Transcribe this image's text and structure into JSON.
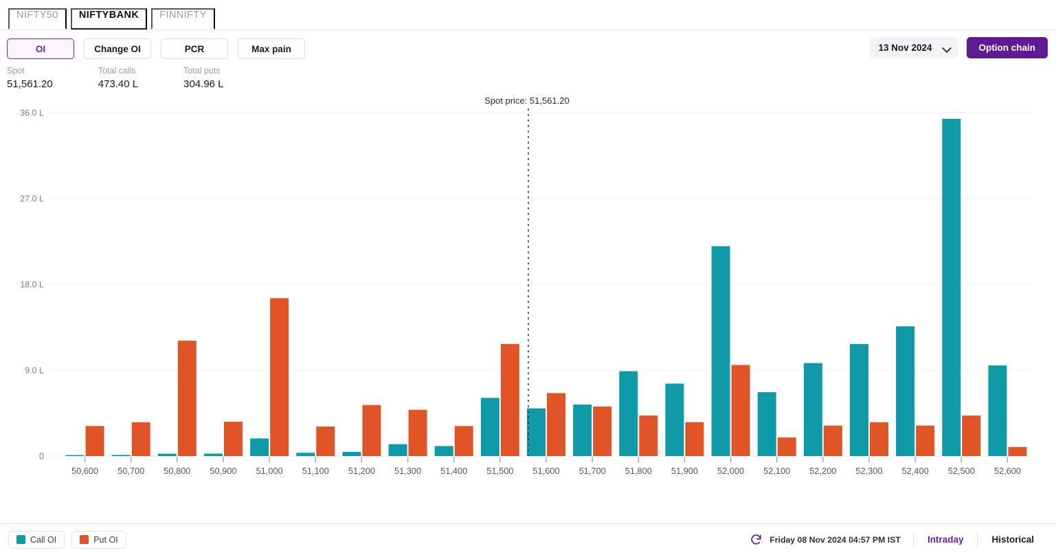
{
  "tabs": [
    {
      "label": "NIFTY50",
      "active": false
    },
    {
      "label": "NIFTYBANK",
      "active": true
    },
    {
      "label": "FINNIFTY",
      "active": false
    }
  ],
  "view_buttons": [
    {
      "label": "OI",
      "active": true
    },
    {
      "label": "Change OI",
      "active": false
    },
    {
      "label": "PCR",
      "active": false
    },
    {
      "label": "Max pain",
      "active": false
    }
  ],
  "expiry": {
    "selected": "13 Nov 2024",
    "icon": "chevron-down-icon"
  },
  "option_chain_button": "Option chain",
  "stats": [
    {
      "label": "Spot",
      "value": "51,561.20"
    },
    {
      "label": "Total calls",
      "value": "473.40 L"
    },
    {
      "label": "Total puts",
      "value": "304.96 L"
    }
  ],
  "spot_annotation": "Spot price: 51,561.20",
  "legend": [
    {
      "label": "Call OI",
      "color": "#0f9aa8"
    },
    {
      "label": "Put OI",
      "color": "#df5528"
    }
  ],
  "footer": {
    "refresh_icon": "refresh-icon",
    "timestamp": "Friday 08 Nov 2024 04:57 PM IST",
    "tabs": [
      {
        "label": "Intraday",
        "active": true
      },
      {
        "label": "Historical",
        "active": false
      }
    ]
  },
  "colors": {
    "call": "#0f9aa8",
    "put": "#df5528",
    "accent": "#5f1a91",
    "grid": "#f0f0f0",
    "spot_line": "#3a3a3a"
  },
  "chart_data": {
    "type": "bar",
    "title": "",
    "xlabel": "",
    "ylabel": "",
    "ylim": [
      0,
      36
    ],
    "yticks": [
      0,
      9,
      18,
      27,
      36
    ],
    "ytick_labels": [
      "0",
      "9.0 L",
      "18.0 L",
      "27.0 L",
      "36.0 L"
    ],
    "grid": true,
    "legend_position": "bottom-left",
    "unit": "L",
    "spot_price": 51561.2,
    "categories": [
      "50,600",
      "50,700",
      "50,800",
      "50,900",
      "51,000",
      "51,100",
      "51,200",
      "51,300",
      "51,400",
      "51,500",
      "51,600",
      "51,700",
      "51,800",
      "51,900",
      "52,000",
      "52,100",
      "52,200",
      "52,300",
      "52,400",
      "52,500",
      "52,600"
    ],
    "series": [
      {
        "name": "Call OI",
        "color": "#0f9aa8",
        "values": [
          0.1,
          0.12,
          0.25,
          0.26,
          1.85,
          0.35,
          0.45,
          1.25,
          1.05,
          6.1,
          5.0,
          5.4,
          8.9,
          7.6,
          22.0,
          6.7,
          9.75,
          11.75,
          13.6,
          35.35,
          9.5
        ]
      },
      {
        "name": "Put OI",
        "color": "#df5528",
        "values": [
          3.15,
          3.55,
          12.1,
          3.6,
          16.55,
          3.1,
          5.35,
          4.85,
          3.15,
          11.75,
          6.6,
          5.2,
          4.25,
          3.55,
          9.55,
          1.95,
          3.2,
          3.55,
          3.2,
          4.25,
          0.95
        ]
      }
    ]
  }
}
